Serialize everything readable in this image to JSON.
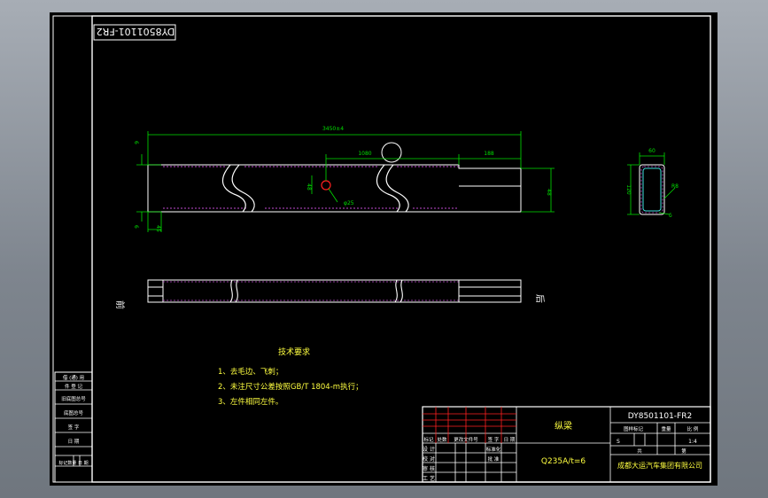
{
  "drawing": {
    "mirrored_code": "DY8501101-FR2",
    "dimensions": {
      "total_length": "3450±4",
      "hole_offset": "1080",
      "end_length": "188",
      "end_height": "48",
      "left_step": "45",
      "hole_height": "48",
      "hole_dia": "φ25",
      "tick_upper": "6",
      "tick_lower": "6",
      "section_width": "60",
      "section_height": "120",
      "section_radius": "R8",
      "section_thickness": "δ"
    },
    "view_labels": {
      "front": "前",
      "rear": "后"
    },
    "tech_requirements": {
      "title": "技术要求",
      "items": [
        "1、去毛边、飞刺；",
        "2、未注尺寸公差按照GB/T 1804-m执行；",
        "3、左件相同左件。"
      ]
    },
    "left_table": [
      "借 (通) 用",
      "件 登 记",
      "旧底图总号",
      "底图总号",
      "签 字",
      "日 期",
      "标记数量 日 期"
    ],
    "title_block": {
      "part_name": "纵梁",
      "material": "Q235A/t=6",
      "drawing_no": "DY8501101-FR2",
      "company": "成都大运汽车集团有限公司",
      "stage_label": "图样标记",
      "weight_label": "重量",
      "weight_value": "重量(kg)",
      "scale_label": "比 例",
      "scale_value": "1:4",
      "sheet_label": "共",
      "sheet_label2": "第",
      "mark_s": "S",
      "revision_header": [
        "标记",
        "处数",
        "更改文件号",
        "签 字",
        "日 期"
      ],
      "roles": [
        "设 计",
        "校 对",
        "审 核",
        "标准化",
        "批 准",
        "工 艺"
      ],
      "roles_right": [
        "标 准 化",
        "批 准"
      ]
    }
  }
}
